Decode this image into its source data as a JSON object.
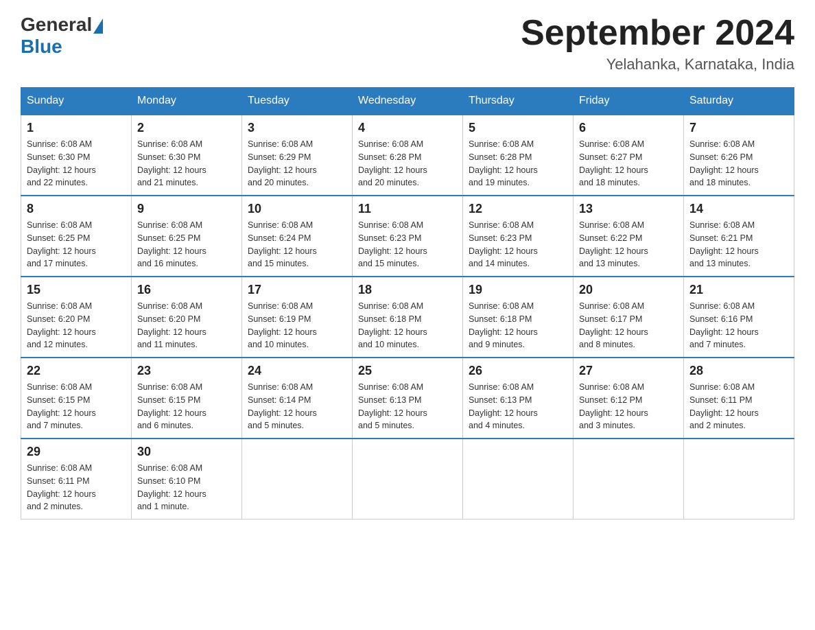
{
  "logo": {
    "general": "General",
    "blue": "Blue"
  },
  "header": {
    "title": "September 2024",
    "subtitle": "Yelahanka, Karnataka, India"
  },
  "days_of_week": [
    "Sunday",
    "Monday",
    "Tuesday",
    "Wednesday",
    "Thursday",
    "Friday",
    "Saturday"
  ],
  "weeks": [
    [
      {
        "day": "1",
        "sunrise": "6:08 AM",
        "sunset": "6:30 PM",
        "daylight": "12 hours and 22 minutes."
      },
      {
        "day": "2",
        "sunrise": "6:08 AM",
        "sunset": "6:30 PM",
        "daylight": "12 hours and 21 minutes."
      },
      {
        "day": "3",
        "sunrise": "6:08 AM",
        "sunset": "6:29 PM",
        "daylight": "12 hours and 20 minutes."
      },
      {
        "day": "4",
        "sunrise": "6:08 AM",
        "sunset": "6:28 PM",
        "daylight": "12 hours and 20 minutes."
      },
      {
        "day": "5",
        "sunrise": "6:08 AM",
        "sunset": "6:28 PM",
        "daylight": "12 hours and 19 minutes."
      },
      {
        "day": "6",
        "sunrise": "6:08 AM",
        "sunset": "6:27 PM",
        "daylight": "12 hours and 18 minutes."
      },
      {
        "day": "7",
        "sunrise": "6:08 AM",
        "sunset": "6:26 PM",
        "daylight": "12 hours and 18 minutes."
      }
    ],
    [
      {
        "day": "8",
        "sunrise": "6:08 AM",
        "sunset": "6:25 PM",
        "daylight": "12 hours and 17 minutes."
      },
      {
        "day": "9",
        "sunrise": "6:08 AM",
        "sunset": "6:25 PM",
        "daylight": "12 hours and 16 minutes."
      },
      {
        "day": "10",
        "sunrise": "6:08 AM",
        "sunset": "6:24 PM",
        "daylight": "12 hours and 15 minutes."
      },
      {
        "day": "11",
        "sunrise": "6:08 AM",
        "sunset": "6:23 PM",
        "daylight": "12 hours and 15 minutes."
      },
      {
        "day": "12",
        "sunrise": "6:08 AM",
        "sunset": "6:23 PM",
        "daylight": "12 hours and 14 minutes."
      },
      {
        "day": "13",
        "sunrise": "6:08 AM",
        "sunset": "6:22 PM",
        "daylight": "12 hours and 13 minutes."
      },
      {
        "day": "14",
        "sunrise": "6:08 AM",
        "sunset": "6:21 PM",
        "daylight": "12 hours and 13 minutes."
      }
    ],
    [
      {
        "day": "15",
        "sunrise": "6:08 AM",
        "sunset": "6:20 PM",
        "daylight": "12 hours and 12 minutes."
      },
      {
        "day": "16",
        "sunrise": "6:08 AM",
        "sunset": "6:20 PM",
        "daylight": "12 hours and 11 minutes."
      },
      {
        "day": "17",
        "sunrise": "6:08 AM",
        "sunset": "6:19 PM",
        "daylight": "12 hours and 10 minutes."
      },
      {
        "day": "18",
        "sunrise": "6:08 AM",
        "sunset": "6:18 PM",
        "daylight": "12 hours and 10 minutes."
      },
      {
        "day": "19",
        "sunrise": "6:08 AM",
        "sunset": "6:18 PM",
        "daylight": "12 hours and 9 minutes."
      },
      {
        "day": "20",
        "sunrise": "6:08 AM",
        "sunset": "6:17 PM",
        "daylight": "12 hours and 8 minutes."
      },
      {
        "day": "21",
        "sunrise": "6:08 AM",
        "sunset": "6:16 PM",
        "daylight": "12 hours and 7 minutes."
      }
    ],
    [
      {
        "day": "22",
        "sunrise": "6:08 AM",
        "sunset": "6:15 PM",
        "daylight": "12 hours and 7 minutes."
      },
      {
        "day": "23",
        "sunrise": "6:08 AM",
        "sunset": "6:15 PM",
        "daylight": "12 hours and 6 minutes."
      },
      {
        "day": "24",
        "sunrise": "6:08 AM",
        "sunset": "6:14 PM",
        "daylight": "12 hours and 5 minutes."
      },
      {
        "day": "25",
        "sunrise": "6:08 AM",
        "sunset": "6:13 PM",
        "daylight": "12 hours and 5 minutes."
      },
      {
        "day": "26",
        "sunrise": "6:08 AM",
        "sunset": "6:13 PM",
        "daylight": "12 hours and 4 minutes."
      },
      {
        "day": "27",
        "sunrise": "6:08 AM",
        "sunset": "6:12 PM",
        "daylight": "12 hours and 3 minutes."
      },
      {
        "day": "28",
        "sunrise": "6:08 AM",
        "sunset": "6:11 PM",
        "daylight": "12 hours and 2 minutes."
      }
    ],
    [
      {
        "day": "29",
        "sunrise": "6:08 AM",
        "sunset": "6:11 PM",
        "daylight": "12 hours and 2 minutes."
      },
      {
        "day": "30",
        "sunrise": "6:08 AM",
        "sunset": "6:10 PM",
        "daylight": "12 hours and 1 minute."
      },
      null,
      null,
      null,
      null,
      null
    ]
  ],
  "labels": {
    "sunrise": "Sunrise:",
    "sunset": "Sunset:",
    "daylight": "Daylight:"
  }
}
